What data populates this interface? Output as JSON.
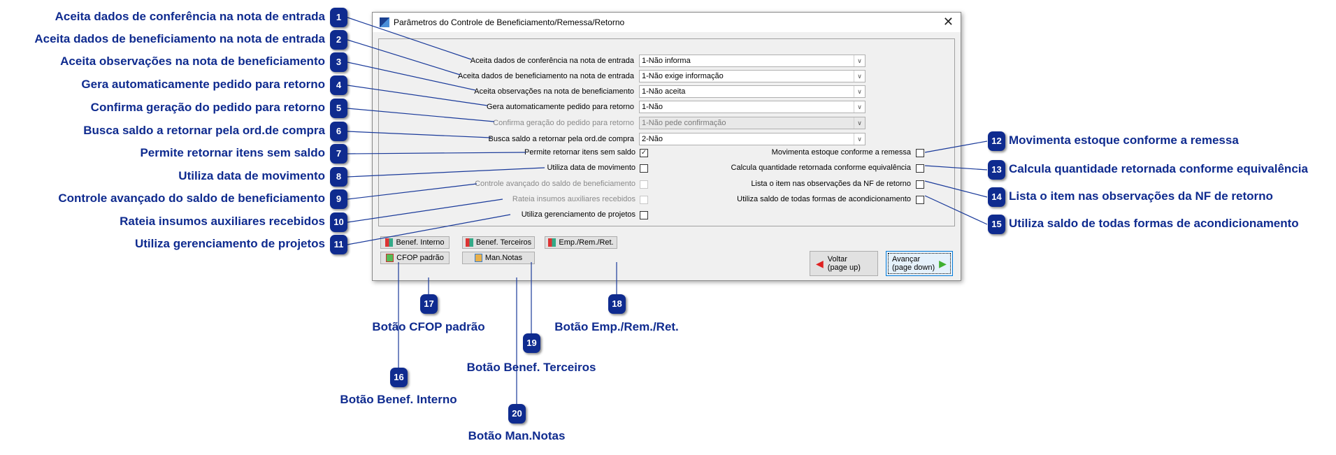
{
  "dialog": {
    "title": "Parâmetros do Controle de Beneficiamento/Remessa/Retorno",
    "close_icon": "close-icon",
    "combos": [
      {
        "label": "Aceita dados de conferência na nota de entrada",
        "value": "1-Não informa",
        "enabled": true
      },
      {
        "label": "Aceita dados de beneficiamento na nota de entrada",
        "value": "1-Não exige informação",
        "enabled": true
      },
      {
        "label": "Aceita observações na nota de beneficiamento",
        "value": "1-Não aceita",
        "enabled": true
      },
      {
        "label": "Gera automaticamente pedido para retorno",
        "value": "1-Não",
        "enabled": true
      },
      {
        "label": "Confirma geração do pedido para retorno",
        "value": "1-Não pede confirmação",
        "enabled": false
      },
      {
        "label": "Busca saldo a retornar pela ord.de compra",
        "value": "2-Não",
        "enabled": true
      }
    ],
    "left_checks": [
      {
        "label": "Permite retornar itens sem saldo",
        "checked": true,
        "enabled": true,
        "mark": "✓"
      },
      {
        "label": "Utiliza data de movimento",
        "checked": false,
        "enabled": true
      },
      {
        "label": "Controle avançado do saldo de beneficiamento",
        "checked": false,
        "enabled": false
      },
      {
        "label": "Rateia insumos auxiliares recebidos",
        "checked": false,
        "enabled": false
      },
      {
        "label": "Utiliza gerenciamento de projetos",
        "checked": false,
        "enabled": true
      }
    ],
    "right_checks": [
      {
        "label": "Movimenta estoque conforme a remessa",
        "checked": false
      },
      {
        "label": "Calcula quantidade retornada conforme equivalência",
        "checked": false
      },
      {
        "label": "Lista o item nas observações da NF de retorno",
        "checked": false
      },
      {
        "label": "Utiliza saldo de todas formas de acondicionamento",
        "checked": false
      }
    ],
    "buttons": {
      "benef_interno": "Benef. Interno",
      "benef_terceiros": "Benef. Terceiros",
      "emp_rem_ret": "Emp./Rem./Ret.",
      "cfop_padrao": "CFOP padrão",
      "man_notas": "Man.Notas",
      "voltar_1": "Voltar",
      "voltar_2": "(page up)",
      "avancar_1": "Avançar",
      "avancar_2": "(page down)"
    }
  },
  "callouts": {
    "left": [
      {
        "n": "1",
        "text": "Aceita dados de conferência na nota de entrada"
      },
      {
        "n": "2",
        "text": "Aceita dados de beneficiamento na nota de entrada"
      },
      {
        "n": "3",
        "text": "Aceita observações na nota de beneficiamento"
      },
      {
        "n": "4",
        "text": "Gera automaticamente pedido para retorno"
      },
      {
        "n": "5",
        "text": "Confirma geração do pedido para retorno"
      },
      {
        "n": "6",
        "text": "Busca saldo a retornar pela ord.de compra"
      },
      {
        "n": "7",
        "text": "Permite retornar itens sem saldo"
      },
      {
        "n": "8",
        "text": "Utiliza data de movimento"
      },
      {
        "n": "9",
        "text": "Controle avançado do saldo de beneficiamento"
      },
      {
        "n": "10",
        "text": "Rateia insumos auxiliares recebidos"
      },
      {
        "n": "11",
        "text": "Utiliza gerenciamento de projetos"
      }
    ],
    "right": [
      {
        "n": "12",
        "text": "Movimenta estoque conforme a remessa"
      },
      {
        "n": "13",
        "text": "Calcula quantidade retornada conforme equivalência"
      },
      {
        "n": "14",
        "text": "Lista o item nas observações da NF de retorno"
      },
      {
        "n": "15",
        "text": "Utiliza saldo de todas formas de acondicionamento"
      }
    ],
    "bottom": [
      {
        "n": "16",
        "text": "Botão Benef. Interno"
      },
      {
        "n": "17",
        "text": "Botão CFOP padrão"
      },
      {
        "n": "18",
        "text": "Botão Emp./Rem./Ret."
      },
      {
        "n": "19",
        "text": "Botão Benef. Terceiros"
      },
      {
        "n": "20",
        "text": "Botão Man.Notas"
      }
    ]
  },
  "colors": {
    "callout": "#0f2b8f",
    "leader_line": "#1a3a9a"
  }
}
